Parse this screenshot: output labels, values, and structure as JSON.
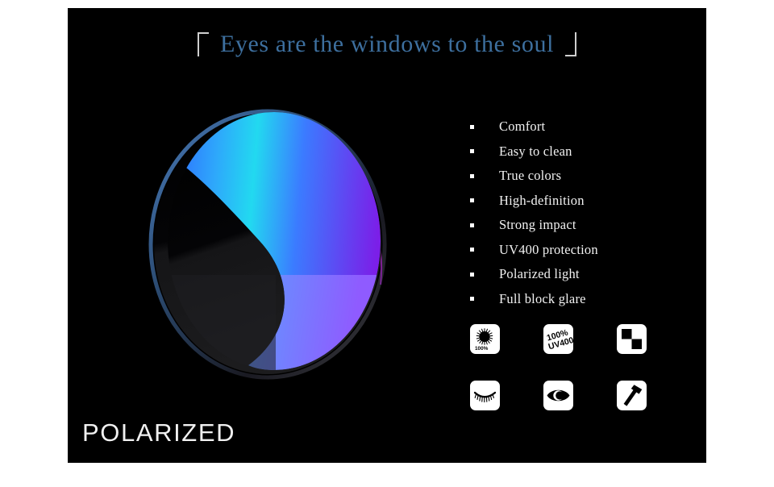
{
  "panel": {
    "background_color": "#000000",
    "page_background": "#ffffff"
  },
  "header": {
    "title": "Eyes are the windows to the soul",
    "title_color": "#3d6f9e",
    "bracket_left": "left-corner-bracket",
    "bracket_right": "right-corner-bracket",
    "bracket_color": "#cfcfcf"
  },
  "lens": {
    "name": "polarized-lens-illustration",
    "rim_top_color": "#b0209a",
    "rim_left_color": "#4a7fc0",
    "gradient_start": "#2f6bff",
    "gradient_mid": "#22d9f0",
    "gradient_end": "#7b1fe8",
    "lower_band_start": "#35dcf0",
    "lower_band_end": "#8f5bff",
    "shadow_color": "#050505"
  },
  "features": {
    "bullet_color": "#ffffff",
    "text_color": "#f2f2f2",
    "items": [
      {
        "label": "Comfort"
      },
      {
        "label": "Easy to clean"
      },
      {
        "label": "True colors"
      },
      {
        "label": "High-definition"
      },
      {
        "label": "Strong impact"
      },
      {
        "label": "UV400 protection"
      },
      {
        "label": "Polarized light"
      },
      {
        "label": "Full block glare"
      }
    ]
  },
  "badges": {
    "badge_background": "#ffffff",
    "glyph_color": "#000000",
    "rows": [
      [
        {
          "icon": "sunburst-100-percent-icon",
          "caption": "100%"
        },
        {
          "icon": "uv400-100-percent-icon",
          "caption_line1": "100%",
          "caption_line2": "UV400"
        },
        {
          "icon": "checkerboard-contrast-icon",
          "caption": ""
        }
      ],
      [
        {
          "icon": "closed-eye-lashes-icon",
          "caption": ""
        },
        {
          "icon": "open-eye-icon",
          "caption": ""
        },
        {
          "icon": "hammer-impact-icon",
          "caption": ""
        }
      ]
    ]
  },
  "footer": {
    "wordmark": "POLARIZED",
    "wordmark_color": "#f0f0f0"
  }
}
